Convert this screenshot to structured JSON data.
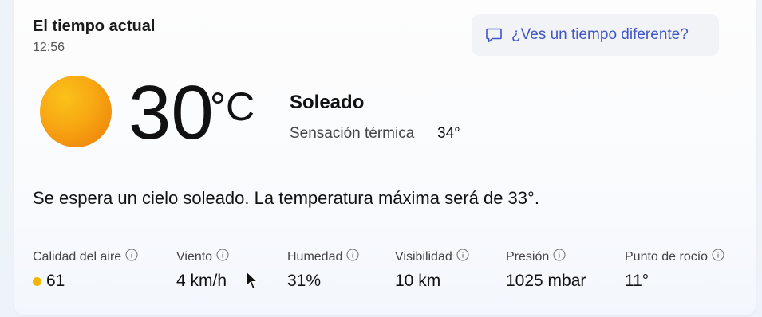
{
  "header": {
    "title": "El tiempo actual",
    "time": "12:56"
  },
  "feedback": {
    "label": "¿Ves un tiempo diferente?",
    "icon": "chat-bubble-icon",
    "color": "#3f56c9"
  },
  "current": {
    "icon": "sun-icon",
    "temperature": "30",
    "unit": "°C",
    "condition": "Soleado",
    "feels_like_label": "Sensación térmica",
    "feels_like_value": "34°"
  },
  "summary": "Se espera un cielo soleado. La temperatura máxima será de 33°.",
  "metrics": [
    {
      "label": "Calidad del aire",
      "value": "61",
      "dot_color": "#f2b705"
    },
    {
      "label": "Viento",
      "value": "4 km/h"
    },
    {
      "label": "Humedad",
      "value": "31%"
    },
    {
      "label": "Visibilidad",
      "value": "10 km"
    },
    {
      "label": "Presión",
      "value": "1025 mbar"
    },
    {
      "label": "Punto de rocío",
      "value": "11°"
    }
  ]
}
